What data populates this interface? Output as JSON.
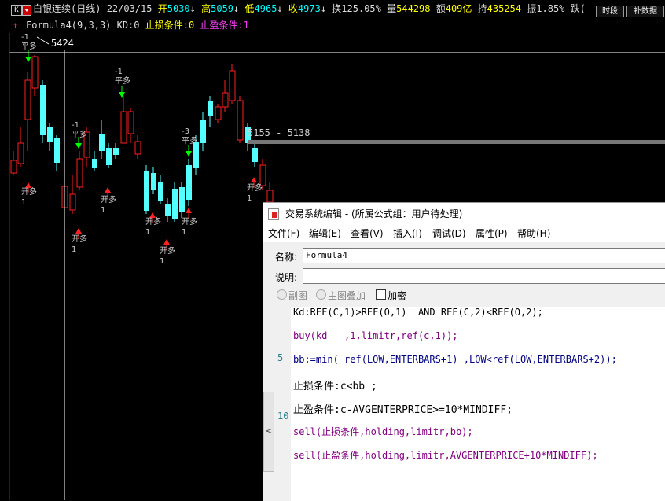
{
  "header": {
    "k_label": "K",
    "symbol": "白银连续(日线)",
    "date": "22/03/15",
    "open_label": "开",
    "open_value": "5030",
    "open_arrow": "↓",
    "high_label": "高",
    "high_value": "5059",
    "high_arrow": "↓",
    "low_label": "低",
    "low_value": "4965",
    "low_arrow": "↓",
    "close_label": "收",
    "close_value": "4973",
    "close_arrow": "↓",
    "turnover_label": "换",
    "turnover_value": "125.05%",
    "volume_label": "量",
    "volume_value": "544298",
    "amount_label": "额",
    "amount_value": "409亿",
    "hold_label": "持",
    "hold_value": "435254",
    "amp_label": "振",
    "amp_value": "1.85%",
    "fall_label": "跌(",
    "btn_timeframe": "时段",
    "btn_fill": "补数据"
  },
  "formula_bar": {
    "arrow": "↑",
    "formula": "Formula4(9,3,3)",
    "kd": "KD:0",
    "stop_loss": "止损条件:0",
    "take_profit": "止盈条件:1"
  },
  "chart": {
    "cross_label": "5424",
    "range_label": "5155 - 5138",
    "signals": [
      {
        "top": "-1",
        "text": "平多",
        "color": "#00ff00"
      },
      {
        "text": "开多",
        "bottom": "1",
        "color": "#ff2020"
      },
      {
        "top": "-1",
        "text": "平多",
        "color": "#00ff00"
      },
      {
        "top": "-1",
        "text": "平多",
        "color": "#00ff00"
      },
      {
        "text": "开多",
        "bottom": "1",
        "color": "#ff2020"
      },
      {
        "text": "开多",
        "bottom": "1",
        "color": "#ff2020"
      },
      {
        "text": "开多",
        "bottom": "1",
        "color": "#ff2020"
      },
      {
        "text": "开多",
        "bottom": "1",
        "color": "#ff2020"
      },
      {
        "top": "-3",
        "text": "平多",
        "color": "#00ff00"
      },
      {
        "text": "开多",
        "bottom": "1",
        "color": "#ff2020"
      },
      {
        "text": "开多",
        "bottom": "1",
        "color": "#ff2020"
      }
    ]
  },
  "dialog": {
    "title": "交易系统编辑 - (所属公式组：用户待处理)",
    "menu": [
      "文件(F)",
      "编辑(E)",
      "查看(V)",
      "插入(I)",
      "调试(D)",
      "属性(P)",
      "帮助(H)"
    ],
    "name_label": "名称:",
    "name_value": "Formula4",
    "desc_label": "说明:",
    "desc_value": "",
    "radio_subchart": "副图",
    "radio_mainchart": "主图叠加",
    "check_encrypt": "加密",
    "collapse_glyph": "<",
    "line_numbers": [
      {
        "n": "5",
        "line": 3
      },
      {
        "n": "10",
        "line": 5
      }
    ],
    "code_lines": [
      "Kd:REF(C,1)>REF(O,1)  AND REF(C,2)<REF(O,2);",
      "buy(kd   ,1,limitr,ref(c,1));",
      "bb:=min( ref(LOW,ENTERBARS+1) ,LOW<ref(LOW,ENTERBARS+2));",
      "止损条件:c<bb ;",
      "止盈条件:c-AVGENTERPRICE>=10*MINDIFF;",
      "sell(止损条件,holding,limitr,bb);",
      "sell(止盈条件,holding,limitr,AVGENTERPRICE+10*MINDIFF);"
    ]
  },
  "colors": {
    "up": "#ff2020",
    "down": "#54ffff",
    "bg": "#000000",
    "cross": "#ffffff"
  }
}
